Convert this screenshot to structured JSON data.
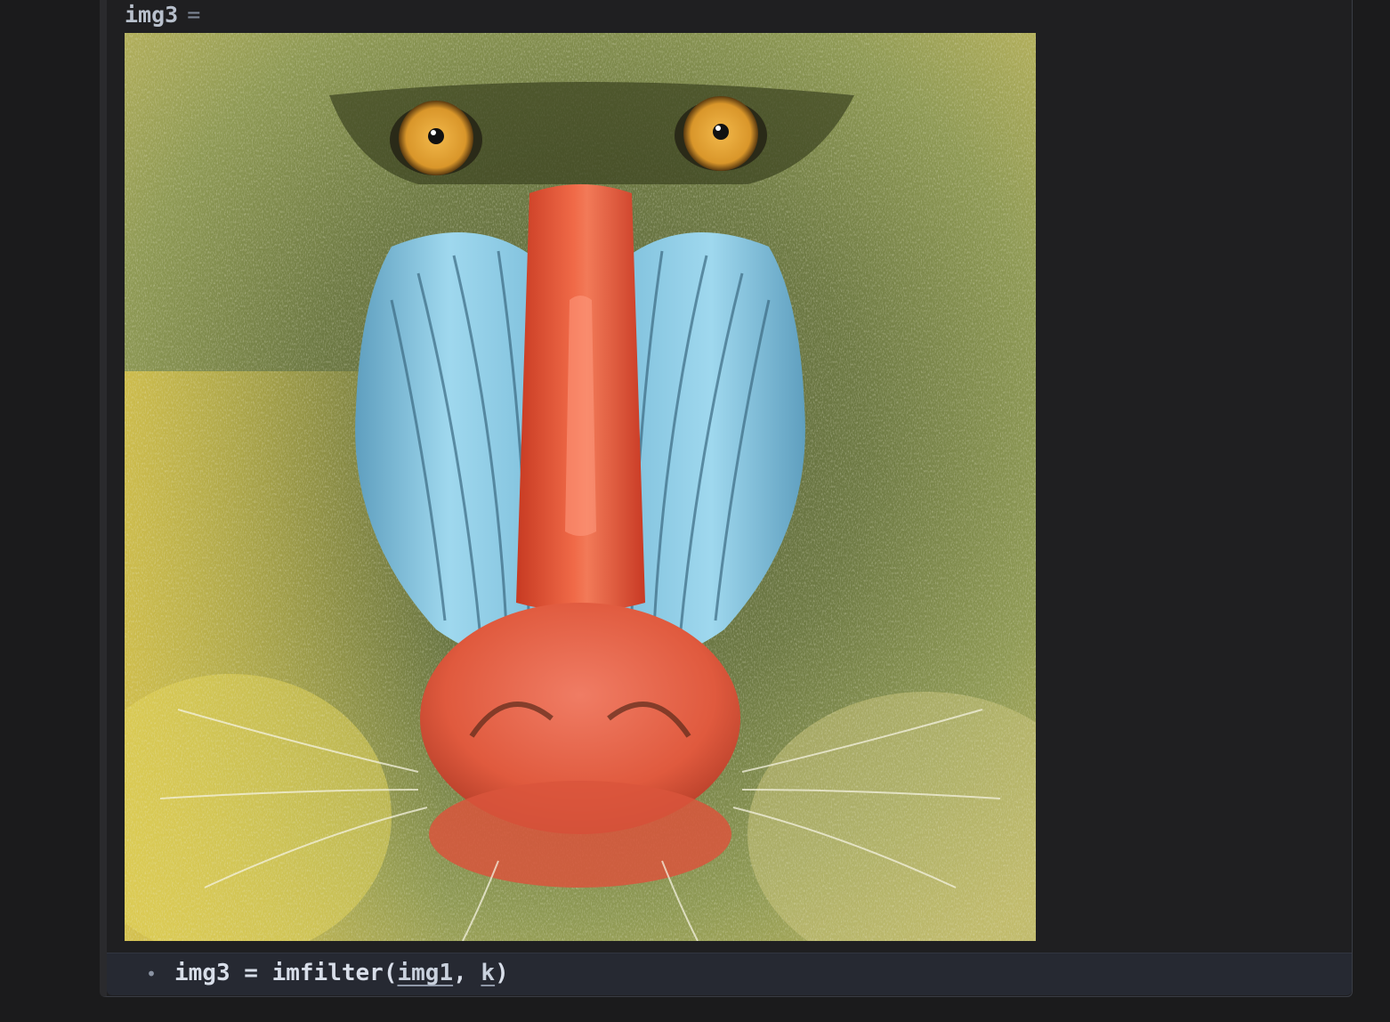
{
  "cell": {
    "output_var": "img3",
    "output_eq": "=",
    "image_alt": "mandrill"
  },
  "input": {
    "bullet": "•",
    "lhs": "img3",
    "assign": " = ",
    "func": "imfilter",
    "open_paren": "(",
    "arg1": "img1",
    "sep": ", ",
    "arg2": "k",
    "close_paren": ")"
  },
  "colors": {
    "background": "#1b1b1c",
    "input_bg": "#262932",
    "text": "#d8dee9",
    "muted": "#7c8594"
  }
}
